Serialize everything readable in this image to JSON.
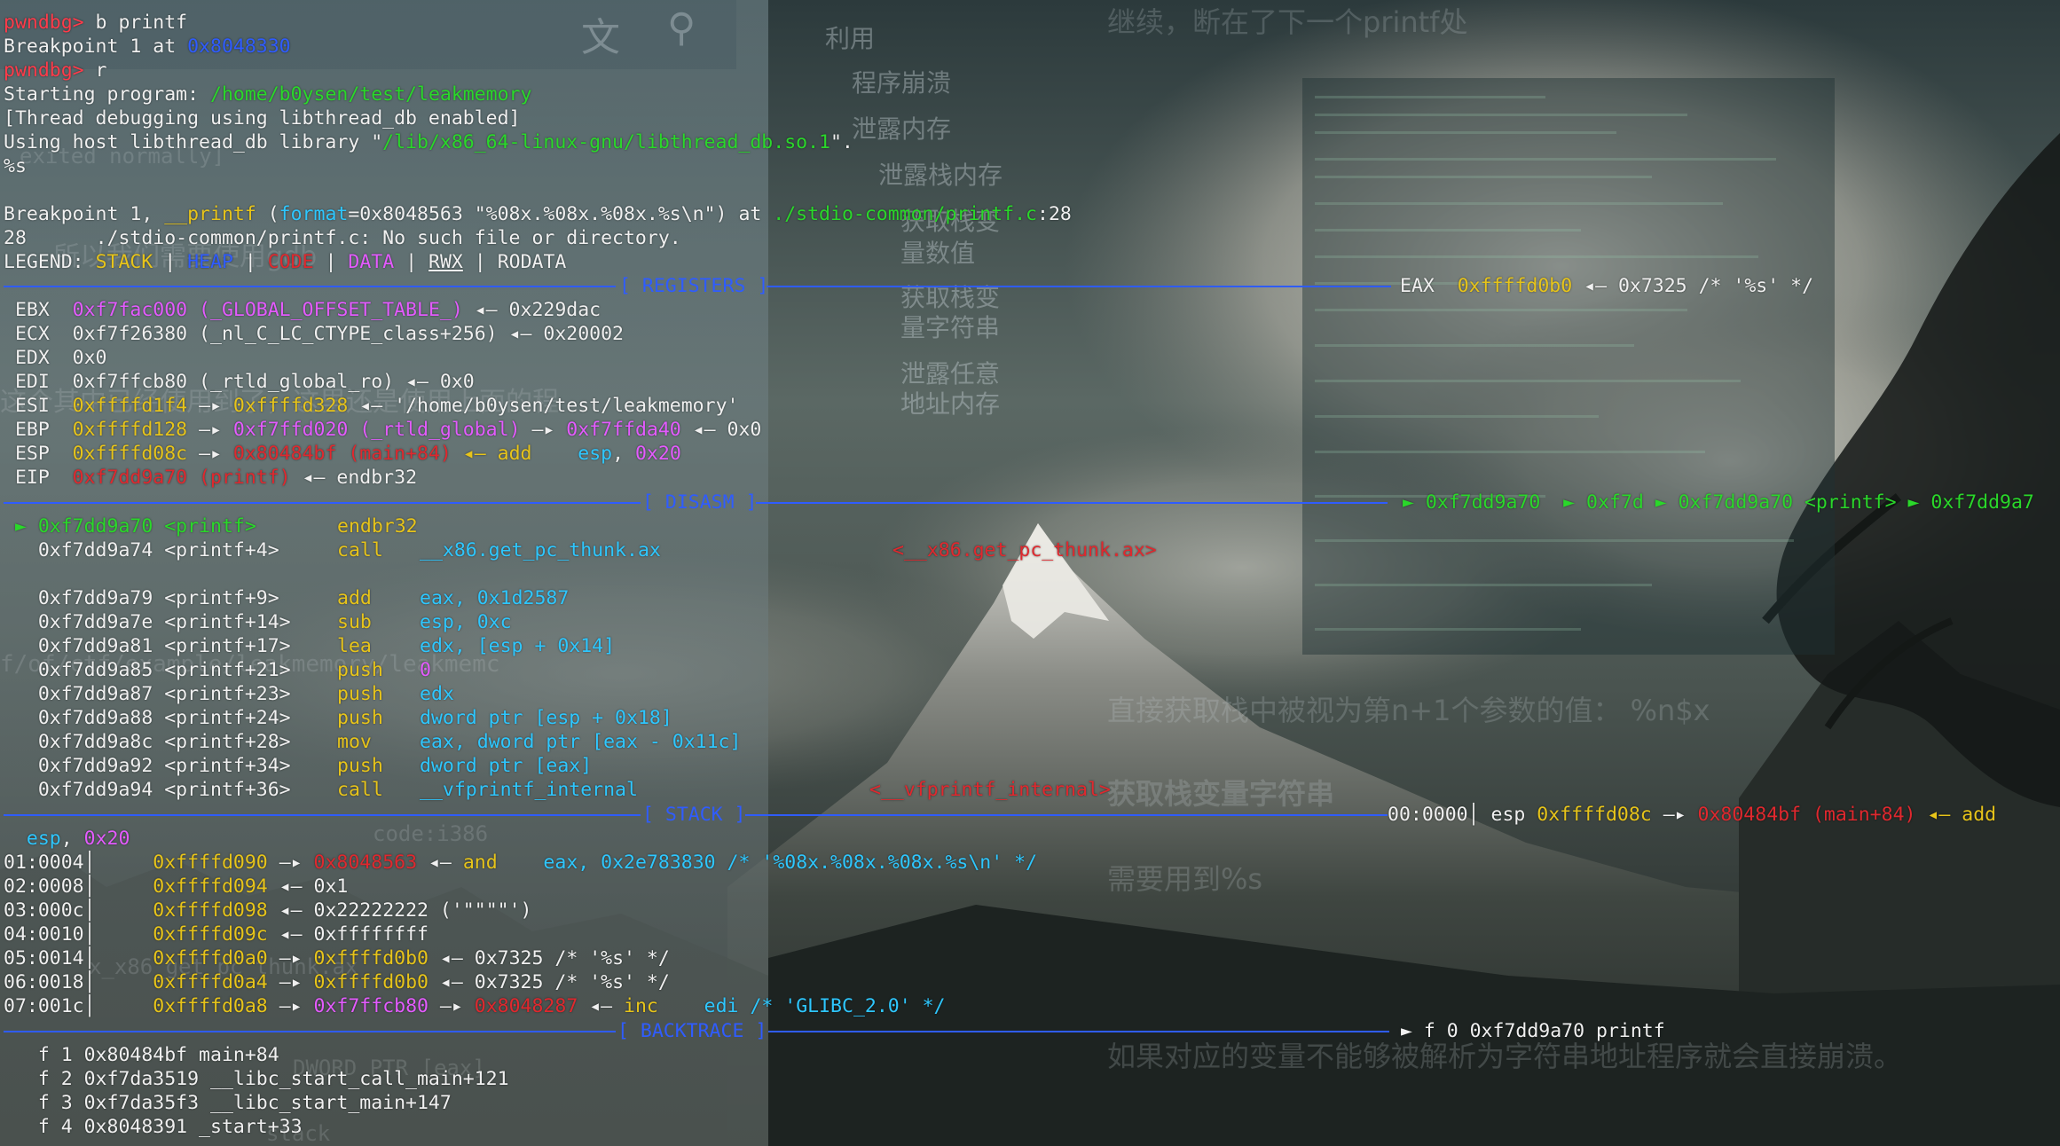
{
  "overlay": {
    "menu_items": [
      "利用",
      "程序崩溃",
      "泄露内存",
      "泄露栈内存",
      "获取栈变",
      "量数值",
      "获取栈变",
      "量字符串",
      "泄露任意",
      "地址内存"
    ],
    "ghost_texts": [
      "继续，断在了下一个printf处",
      "直接获取栈中被视为第n+1个参数的值：  %n$x",
      "获取栈变量字符串",
      "需要用到%s",
      "如果对应的变量不能够被解析为字符串地址程序就会直接崩溃。"
    ],
    "ghost_left": [
      "exited normally]",
      "所以我们需要使用gdb",
      "这个其中已经使用到了，这里还是使用上面的程",
      "f/of/ctf/example/leakmemory/leakmemc",
      "x_x86_get_pc_thunk.ax",
      "code:i386",
      "DWORD PTR [eax]",
      "stack"
    ]
  },
  "terminal": {
    "l01": {
      "prompt": "pwndbg>",
      "cmd": " b printf"
    },
    "l02": {
      "text": "Breakpoint 1 at ",
      "addr": "0x8048330"
    },
    "l03": {
      "prompt": "pwndbg>",
      "cmd": " r"
    },
    "l04": {
      "text": "Starting program: ",
      "path": "/home/b0ysen/test/leakmemory"
    },
    "l05": {
      "text": "[Thread debugging using libthread_db enabled]"
    },
    "l06": {
      "text": "Using host libthread_db library \"",
      "path": "/lib/x86_64-linux-gnu/libthread_db.so.1",
      "tail": "\"."
    },
    "l07": {
      "text": "%s"
    },
    "l08": {
      "a": "Breakpoint 1, ",
      "fn": "__printf",
      "b": " (",
      "arg": "format",
      "c": "=0x8048563 \"%08x.%08x.%08x.%s\\n\") at ",
      "file": "./stdio-common/printf.c",
      "d": ":28"
    },
    "l09": {
      "text": "28\t./stdio-common/printf.c: No such file or directory."
    },
    "legend": {
      "label": "LEGEND: ",
      "stack": "STACK",
      "heap": "HEAP",
      "code": "CODE",
      "data": "DATA",
      "rwx": "RWX",
      "rodata": "RODATA",
      "sep": " | "
    },
    "sections": {
      "registers": "[ REGISTERS ]",
      "disasm": "[ DISASM ]",
      "stack": "[ STACK ]",
      "backtrace": "[ BACKTRACE ]"
    },
    "eax": {
      "name": "EAX",
      "val": "0xffffd0b0",
      "rest": " ◂— 0x7325 /* '%s' */"
    },
    "regs": [
      {
        "name": " EBX",
        "v1": "0xf7fac000 (_GLOBAL_OFFSET_TABLE_)",
        "rest": " ◂— 0x229dac"
      },
      {
        "name": " ECX",
        "v1": "0xf7f26380 (_nl_C_LC_CTYPE_class+256)",
        "rest": " ◂— 0x20002"
      },
      {
        "name": " EDX",
        "v1": "0x0",
        "rest": ""
      },
      {
        "name": " EDI",
        "v1": "0xf7ffcb80 (_rtld_global_ro)",
        "rest": " ◂— 0x0"
      },
      {
        "name": " ESI",
        "v1": "0xffffd1f4",
        "a1": " —▸ ",
        "v2": "0xffffd328",
        "rest": " ◂— '/home/b0ysen/test/leakmemory'"
      },
      {
        "name": " EBP",
        "v1": "0xffffd128",
        "a1": " —▸ ",
        "v2": "0xf7ffd020 (_rtld_global)",
        "a2": " —▸ ",
        "v3": "0xf7ffda40",
        "rest": " ◂— 0x0"
      },
      {
        "name": " ESP",
        "v1": "0xffffd08c",
        "a1": " —▸ ",
        "v2": "0x80484bf (main+84)",
        "rest": " ◂— add    ",
        "r2": "esp",
        "r3": ", ",
        "r4": "0x20"
      },
      {
        "name": " EIP",
        "v1": "0xf7dd9a70 (printf)",
        "rest": " ◂— endbr32"
      }
    ],
    "disasm_right": " ► 0xf7dd9a70  ► 0xf7d ► 0xf7dd9a70 <printf> ► 0xf7dd9a7",
    "disasm": [
      {
        "addr": " ► 0xf7dd9a70 <printf>",
        "mn": "endbr32",
        "op": "",
        "cm": ""
      },
      {
        "addr": "   0xf7dd9a74 <printf+4>",
        "mn": "call",
        "op": "__x86.get_pc_thunk.ax",
        "cm": "<__x86.get_pc_thunk.ax>"
      },
      {
        "addr": "",
        "mn": "",
        "op": "",
        "cm": ""
      },
      {
        "addr": "   0xf7dd9a79 <printf+9>",
        "mn": "add",
        "op": "eax, 0x1d2587",
        "cm": ""
      },
      {
        "addr": "   0xf7dd9a7e <printf+14>",
        "mn": "sub",
        "op": "esp, 0xc",
        "cm": ""
      },
      {
        "addr": "   0xf7dd9a81 <printf+17>",
        "mn": "lea",
        "op": "edx, [esp + 0x14]",
        "cm": ""
      },
      {
        "addr": "   0xf7dd9a85 <printf+21>",
        "mn": "push",
        "op": "0",
        "cm": ""
      },
      {
        "addr": "   0xf7dd9a87 <printf+23>",
        "mn": "push",
        "op": "edx",
        "cm": ""
      },
      {
        "addr": "   0xf7dd9a88 <printf+24>",
        "mn": "push",
        "op": "dword ptr [esp + 0x18]",
        "cm": ""
      },
      {
        "addr": "   0xf7dd9a8c <printf+28>",
        "mn": "mov",
        "op": "eax, dword ptr [eax - 0x11c]",
        "cm": ""
      },
      {
        "addr": "   0xf7dd9a92 <printf+34>",
        "mn": "push",
        "op": "dword ptr [eax]",
        "cm": ""
      },
      {
        "addr": "   0xf7dd9a94 <printf+36>",
        "mn": "call",
        "op": "__vfprintf_internal",
        "cm": "<__vfprintf_internal>"
      }
    ],
    "stack_right": {
      "idx": "00:0000│",
      "reg": " esp ",
      "v1": "0xffffd08c",
      "a1": " —▸ ",
      "v2": "0x80484bf (main+84)",
      "rest": " ◂— add"
    },
    "stack_cont": {
      "a": "  esp",
      "b": ", ",
      "c": "0x20"
    },
    "stack": [
      {
        "idx": "01:0004│",
        "v1": "0xffffd090",
        "a1": " —▸ ",
        "v2": "0x8048563",
        "rest": " ◂— ",
        "mn": "and",
        "op": "    eax, 0x2e783830 /* '%08x.%08x.%08x.%s\\n' */"
      },
      {
        "idx": "02:0008│",
        "v1": "0xffffd094",
        "a1": " ◂— ",
        "v2": "",
        "rest": "0x1",
        "mn": "",
        "op": ""
      },
      {
        "idx": "03:000c│",
        "v1": "0xffffd098",
        "a1": " ◂— ",
        "v2": "",
        "rest": "0x22222222 ('\"\"\"\"')",
        "mn": "",
        "op": ""
      },
      {
        "idx": "04:0010│",
        "v1": "0xffffd09c",
        "a1": " ◂— ",
        "v2": "",
        "rest": "0xffffffff",
        "mn": "",
        "op": ""
      },
      {
        "idx": "05:0014│",
        "v1": "0xffffd0a0",
        "a1": " —▸ ",
        "v2": "0xffffd0b0",
        "rest": " ◂— 0x7325 /* '%s' */",
        "mn": "",
        "op": ""
      },
      {
        "idx": "06:0018│",
        "v1": "0xffffd0a4",
        "a1": " —▸ ",
        "v2": "0xffffd0b0",
        "rest": " ◂— 0x7325 /* '%s' */",
        "mn": "",
        "op": ""
      },
      {
        "idx": "07:001c│",
        "v1": "0xffffd0a8",
        "a1": " —▸ ",
        "v2": "0xf7ffcb80",
        "a2": " —▸ ",
        "v3": "0x8048287",
        "rest": " ◂— ",
        "mn": "inc",
        "op": "    edi /* 'GLIBC_2.0' */"
      }
    ],
    "bt_right": " ► f 0 0xf7dd9a70 printf",
    "backtrace": [
      "   f 1 0x80484bf main+84",
      "   f 2 0xf7da3519 __libc_start_call_main+121",
      "   f 3 0xf7da35f3 __libc_start_main+147",
      "   f 4 0x8048391 _start+33"
    ]
  }
}
